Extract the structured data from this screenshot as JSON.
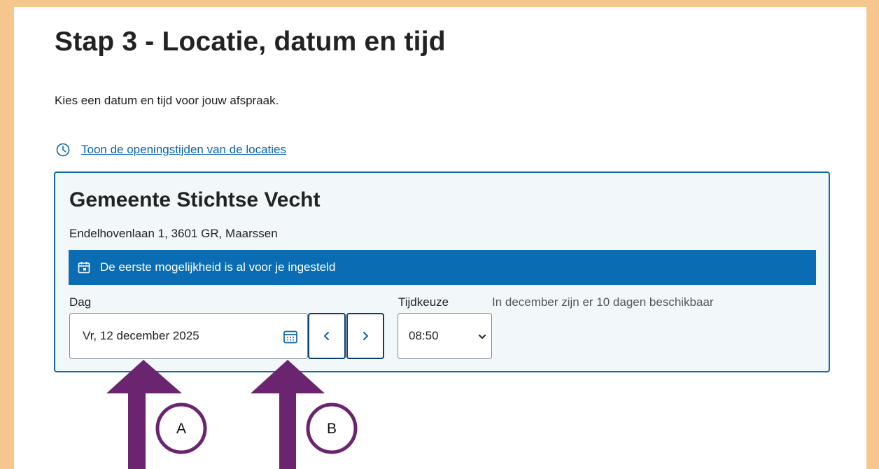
{
  "page": {
    "title": "Stap 3 - Locatie, datum en tijd",
    "intro": "Kies een datum en tijd voor jouw afspraak.",
    "opening_hours_link": "Toon de openingstijden van de locaties"
  },
  "location": {
    "name": "Gemeente Stichtse Vecht",
    "address": "Endelhovenlaan 1, 3601 GR, Maarssen",
    "banner_text": "De eerste mogelijkheid is al voor je ingesteld"
  },
  "form": {
    "day_label": "Dag",
    "date_value": "Vr, 12 december 2025",
    "prev_icon": "chevron-left-icon",
    "next_icon": "chevron-right-icon",
    "calendar_icon": "calendar-icon",
    "time_label": "Tijdkeuze",
    "time_value": "08:50",
    "availability": "In december zijn er 10 dagen beschikbaar"
  },
  "annotations": {
    "callout_a": "A",
    "callout_b": "B",
    "arrow_color": "#6b2570"
  },
  "colors": {
    "frame": "#f5c78f",
    "accent_blue": "#0a6cb3",
    "card_bg": "#f2f7fa",
    "link": "#0a64b0"
  }
}
